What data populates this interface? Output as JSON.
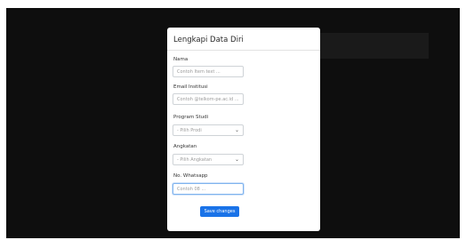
{
  "modal": {
    "title": "Lengkapi Data Diri",
    "save_label": "Save changes"
  },
  "form": {
    "nama": {
      "label": "Nama",
      "placeholder": "Contoh Item text ..."
    },
    "email": {
      "label": "Email Institusi",
      "placeholder": "Contoh @telkom-pe.ac.id ..."
    },
    "prodi": {
      "label": "Program Studi",
      "selected": "- Pilih Prodi"
    },
    "angkatan": {
      "label": "Angkatan",
      "selected": "- Pilih Angkatan"
    },
    "whatsapp": {
      "label": "No. Whatsapp",
      "placeholder": "Contoh 08 ..."
    }
  },
  "icons": {
    "select_caret": "chevron-down-icon"
  }
}
